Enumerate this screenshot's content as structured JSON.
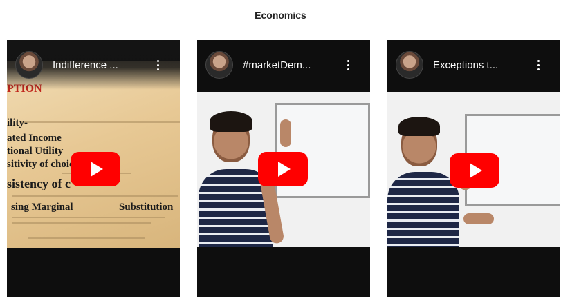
{
  "section": {
    "title": "Economics"
  },
  "videos": [
    {
      "title": "Indifference ...",
      "avatar": "channel-avatar",
      "menu_icon": "more-vert-icon",
      "play_icon": "youtube-play-icon",
      "thumbnail_text": [
        "PTION",
        "ility-",
        "ated Income",
        "tional Utility",
        "sitivity of choice",
        "sistency of c",
        "sing Marginal",
        "Substitution"
      ]
    },
    {
      "title": "#marketDem...",
      "avatar": "channel-avatar",
      "menu_icon": "more-vert-icon",
      "play_icon": "youtube-play-icon"
    },
    {
      "title": "Exceptions t...",
      "avatar": "channel-avatar",
      "menu_icon": "more-vert-icon",
      "play_icon": "youtube-play-icon"
    }
  ],
  "colors": {
    "play_button": "#ff0000",
    "card_background": "#0e0e0e",
    "page_background": "#ffffff"
  }
}
